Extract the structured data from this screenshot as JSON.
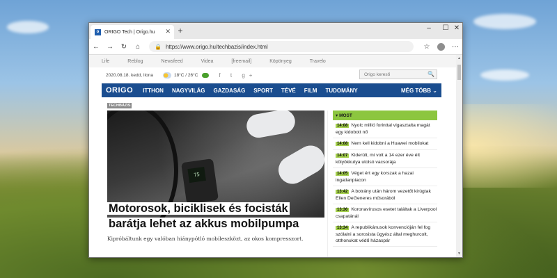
{
  "browser": {
    "tab_title": "ORIGO Tech | Origo.hu",
    "url": "https://www.origo.hu/techbazis/index.html",
    "favicon_letter": "o",
    "window_controls": [
      "–",
      "☐",
      "✕"
    ]
  },
  "icons": {
    "back": "←",
    "forward": "→",
    "refresh": "↻",
    "home": "⌂",
    "lock": "🔒",
    "star": "☆",
    "menu": "⋯",
    "close": "✕",
    "plus": "+",
    "search": "🔍",
    "chevron": "⌄"
  },
  "toplinks": [
    "Life",
    "Reblog",
    "Newsfeed",
    "Videa",
    "[freemail]",
    "Köpönyeg",
    "Travelo"
  ],
  "util": {
    "date": "2020.08.18. kedd, Ilona",
    "temperature": "18°C / 26°C",
    "social": "f  t  g+",
    "search_placeholder": "Origo kereső"
  },
  "mainnav": {
    "logo": "ORIGO",
    "items": [
      "ITTHON",
      "NAGYVILÁG",
      "GAZDASÁG",
      "SPORT",
      "TÉVÉ",
      "FILM",
      "TUDOMÁNY"
    ],
    "more": "MÉG TÖBB ⌄"
  },
  "section_tag": "TECHBÁZIS",
  "article": {
    "headline_line1": "Motorosok, biciklisek és focisták",
    "headline_line2": "barátja lehet az akkus mobilpumpa",
    "lead": "Kipróbáltunk egy valóban hiánypótló mobileszközt, az okos kompresszort.",
    "pump_display": "75"
  },
  "sidebar": {
    "title": "▾  MOST",
    "news": [
      {
        "time": "14:08",
        "text": "Nyolc millió forinttal vigasztalta magát egy kidobott nő"
      },
      {
        "time": "14:08",
        "text": "Nem kell kidobni a Huawei mobilokat"
      },
      {
        "time": "14:07",
        "text": "Kiderült, mi volt a 14 ezer éve élt kölyökkutya utolsó vacsorája"
      },
      {
        "time": "14:05",
        "text": "Véget ért egy korszak a hazai ingatlanpiacon"
      },
      {
        "time": "13:42",
        "text": "A botrány után három vezetőt kirúgtak Ellen DeGeneres műsorából"
      },
      {
        "time": "13:36",
        "text": "Koronavírusos esetet találtak a Liverpool csapatánál"
      },
      {
        "time": "13:34",
        "text": "A republikánusok konvencióján fel fog szólalni a sorosista ügyész által meghurcolt, otthonukat védő házaspár"
      }
    ]
  }
}
